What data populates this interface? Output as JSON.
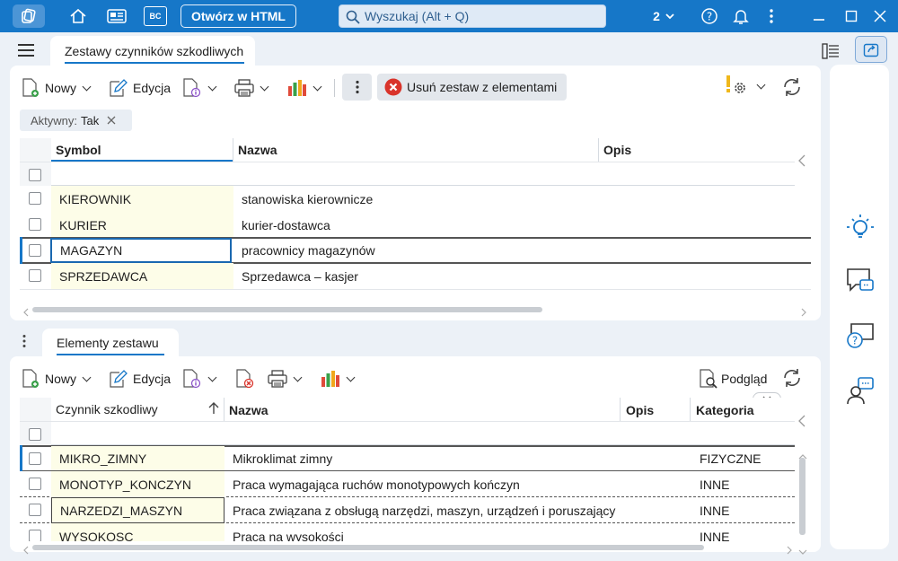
{
  "titlebar": {
    "html_button": "Otwórz w HTML",
    "search_placeholder": "Wyszukaj (Alt + Q)",
    "company_short": "2",
    "bc_label": "BC"
  },
  "main_tab": "Zestawy czynników szkodliwych",
  "toolbar_top": {
    "new": "Nowy",
    "edit": "Edycja",
    "delete_set": "Usuń zestaw z elementami"
  },
  "filter_chip": {
    "label": "Aktywny:",
    "value": "Tak"
  },
  "grid1": {
    "columns": [
      "Symbol",
      "Nazwa",
      "Opis"
    ],
    "rows": [
      {
        "symbol": "KIEROWNIK",
        "name": "stanowiska kierownicze"
      },
      {
        "symbol": "KURIER",
        "name": "kurier-dostawca"
      },
      {
        "symbol": "MAGAZYN",
        "name": "pracownicy magazynów"
      },
      {
        "symbol": "SPRZEDAWCA",
        "name": "Sprzedawca – kasjer"
      }
    ]
  },
  "sub_tab": "Elementy zestawu",
  "toolbar_bottom": {
    "new": "Nowy",
    "edit": "Edycja",
    "preview": "Podgląd"
  },
  "grid2": {
    "columns": [
      "Czynnik szkodliwy",
      "Nazwa",
      "Opis",
      "Kategoria"
    ],
    "rows": [
      {
        "factor": "MIKRO_ZIMNY",
        "name": "Mikroklimat zimny",
        "category": "FIZYCZNE"
      },
      {
        "factor": "MONOTYP_KONCZYN",
        "name": "Praca wymagająca ruchów monotypowych kończyn",
        "category": "INNE"
      },
      {
        "factor": "NARZEDZI_MASZYN",
        "name": "Praca związana z obsługą narzędzi, maszyn, urządzeń i poruszający",
        "category": "INNE"
      },
      {
        "factor": "WYSOKOSC",
        "name": "Praca na wysokości",
        "category": "INNE"
      }
    ]
  },
  "colors": {
    "accent": "#1677c8",
    "symbol_bg": "#fdfde8",
    "delete_red": "#d9342b"
  }
}
